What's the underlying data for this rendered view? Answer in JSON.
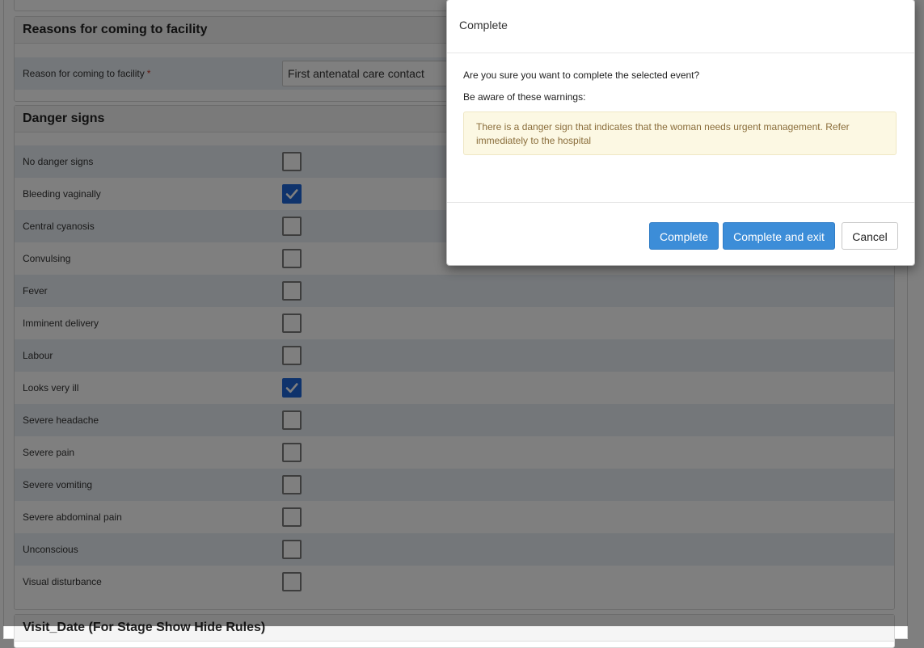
{
  "reasons_section": {
    "title": "Reasons for coming to facility",
    "reason_label": "Reason for coming to facility",
    "required_marker": "*",
    "reason_value": "First antenatal care contact"
  },
  "danger_section": {
    "title": "Danger signs",
    "items": [
      {
        "label": "No danger signs",
        "checked": false
      },
      {
        "label": "Bleeding vaginally",
        "checked": true
      },
      {
        "label": "Central cyanosis",
        "checked": false
      },
      {
        "label": "Convulsing",
        "checked": false
      },
      {
        "label": "Fever",
        "checked": false
      },
      {
        "label": "Imminent delivery",
        "checked": false
      },
      {
        "label": "Labour",
        "checked": false
      },
      {
        "label": "Looks very ill",
        "checked": true
      },
      {
        "label": "Severe headache",
        "checked": false
      },
      {
        "label": "Severe pain",
        "checked": false
      },
      {
        "label": "Severe vomiting",
        "checked": false
      },
      {
        "label": "Severe abdominal pain",
        "checked": false
      },
      {
        "label": "Unconscious",
        "checked": false
      },
      {
        "label": "Visual disturbance",
        "checked": false
      }
    ]
  },
  "next_section": {
    "title": "Visit_Date (For Stage Show Hide Rules)"
  },
  "modal": {
    "title": "Complete",
    "confirm_text": "Are you sure you want to complete the selected event?",
    "warnings_intro": "Be aware of these warnings:",
    "warning_text": "There is a danger sign that indicates that the woman needs urgent management. Refer immediately to the hospital",
    "buttons": {
      "complete": "Complete",
      "complete_and_exit": "Complete and exit",
      "cancel": "Cancel"
    }
  },
  "colors": {
    "primary": "#3c8dd8",
    "checkbox_checked": "#1e66d8",
    "warning_bg": "#fcf8e3",
    "warning_text": "#8a6d3b",
    "row_shade": "#e8eef4"
  }
}
